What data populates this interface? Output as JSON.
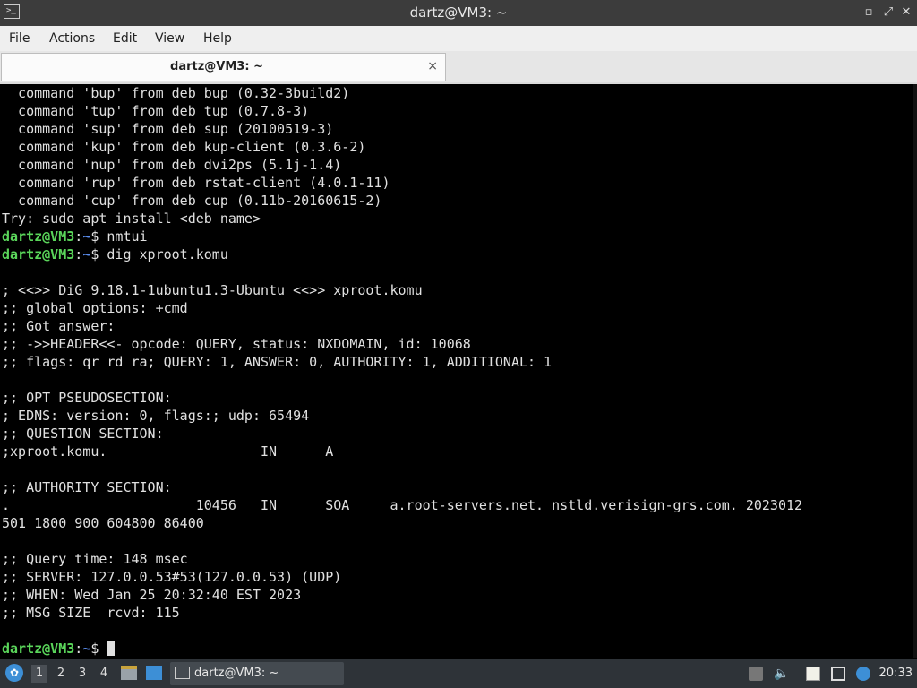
{
  "window": {
    "title": "dartz@VM3: ~"
  },
  "menu": [
    "File",
    "Actions",
    "Edit",
    "View",
    "Help"
  ],
  "tab": {
    "label": "dartz@VM3: ~",
    "close": "×"
  },
  "prompt": {
    "user": "dartz@VM3",
    "sep": ":",
    "path": "~",
    "symbol": "$ "
  },
  "terminal_lines": [
    {
      "type": "text",
      "text": "  command 'bup' from deb bup (0.32-3build2)"
    },
    {
      "type": "text",
      "text": "  command 'tup' from deb tup (0.7.8-3)"
    },
    {
      "type": "text",
      "text": "  command 'sup' from deb sup (20100519-3)"
    },
    {
      "type": "text",
      "text": "  command 'kup' from deb kup-client (0.3.6-2)"
    },
    {
      "type": "text",
      "text": "  command 'nup' from deb dvi2ps (5.1j-1.4)"
    },
    {
      "type": "text",
      "text": "  command 'rup' from deb rstat-client (4.0.1-11)"
    },
    {
      "type": "text",
      "text": "  command 'cup' from deb cup (0.11b-20160615-2)"
    },
    {
      "type": "text",
      "text": "Try: sudo apt install <deb name>"
    },
    {
      "type": "prompt",
      "cmd": "nmtui"
    },
    {
      "type": "prompt",
      "cmd": "dig xproot.komu"
    },
    {
      "type": "text",
      "text": ""
    },
    {
      "type": "text",
      "text": "; <<>> DiG 9.18.1-1ubuntu1.3-Ubuntu <<>> xproot.komu"
    },
    {
      "type": "text",
      "text": ";; global options: +cmd"
    },
    {
      "type": "text",
      "text": ";; Got answer:"
    },
    {
      "type": "text",
      "text": ";; ->>HEADER<<- opcode: QUERY, status: NXDOMAIN, id: 10068"
    },
    {
      "type": "text",
      "text": ";; flags: qr rd ra; QUERY: 1, ANSWER: 0, AUTHORITY: 1, ADDITIONAL: 1"
    },
    {
      "type": "text",
      "text": ""
    },
    {
      "type": "text",
      "text": ";; OPT PSEUDOSECTION:"
    },
    {
      "type": "text",
      "text": "; EDNS: version: 0, flags:; udp: 65494"
    },
    {
      "type": "text",
      "text": ";; QUESTION SECTION:"
    },
    {
      "type": "text",
      "text": ";xproot.komu.                   IN      A"
    },
    {
      "type": "text",
      "text": ""
    },
    {
      "type": "text",
      "text": ";; AUTHORITY SECTION:"
    },
    {
      "type": "text",
      "text": ".                       10456   IN      SOA     a.root-servers.net. nstld.verisign-grs.com. 2023012"
    },
    {
      "type": "text",
      "text": "501 1800 900 604800 86400"
    },
    {
      "type": "text",
      "text": ""
    },
    {
      "type": "text",
      "text": ";; Query time: 148 msec"
    },
    {
      "type": "text",
      "text": ";; SERVER: 127.0.0.53#53(127.0.0.53) (UDP)"
    },
    {
      "type": "text",
      "text": ";; WHEN: Wed Jan 25 20:32:40 EST 2023"
    },
    {
      "type": "text",
      "text": ";; MSG SIZE  rcvd: 115"
    },
    {
      "type": "text",
      "text": ""
    },
    {
      "type": "prompt",
      "cmd": "",
      "cursor": true
    }
  ],
  "taskbar": {
    "workspaces": [
      "1",
      "2",
      "3",
      "4"
    ],
    "active_workspace": "1",
    "task_label": "dartz@VM3: ~",
    "clock": "20:33"
  },
  "icons": {
    "app": "terminal-icon",
    "minimize": "minimize-icon",
    "restore": "restore-icon",
    "close": "close-icon",
    "start": "start-menu-icon",
    "files": "file-manager-icon",
    "desktop": "show-desktop-icon",
    "task": "terminal-icon",
    "tray": [
      "notification-icon",
      "volume-icon",
      "clipboard-icon",
      "network-icon",
      "update-icon"
    ]
  },
  "colors": {
    "prompt_user": "#5ad55a",
    "prompt_path": "#5b8ef0",
    "terminal_bg": "#000000",
    "terminal_fg": "#e0e0e0"
  }
}
